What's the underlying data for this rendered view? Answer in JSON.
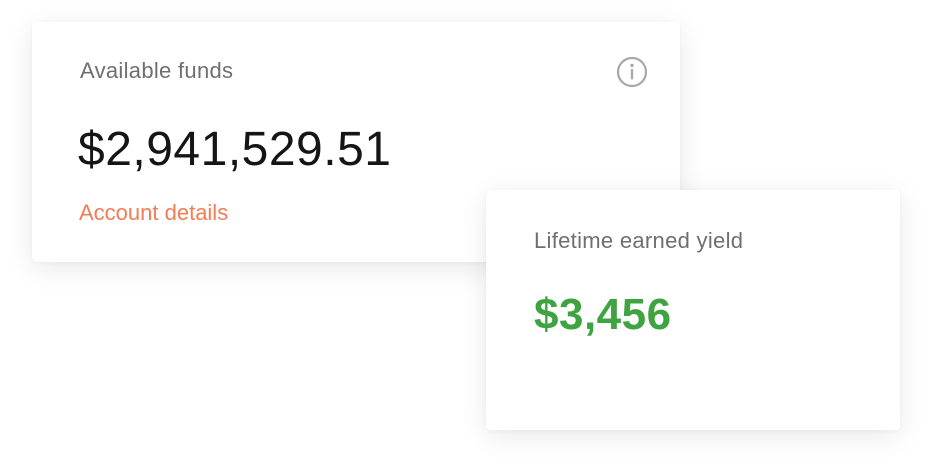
{
  "available_funds": {
    "label": "Available funds",
    "amount": "$2,941,529.51",
    "link_label": "Account details",
    "info_icon": "info-icon"
  },
  "lifetime_yield": {
    "label": "Lifetime earned yield",
    "amount": "$3,456"
  },
  "colors": {
    "label_text": "#6f6f6f",
    "amount_text": "#151515",
    "link_accent": "#f47c55",
    "yield_green": "#3ea340",
    "icon_gray": "#a8a8a8"
  }
}
